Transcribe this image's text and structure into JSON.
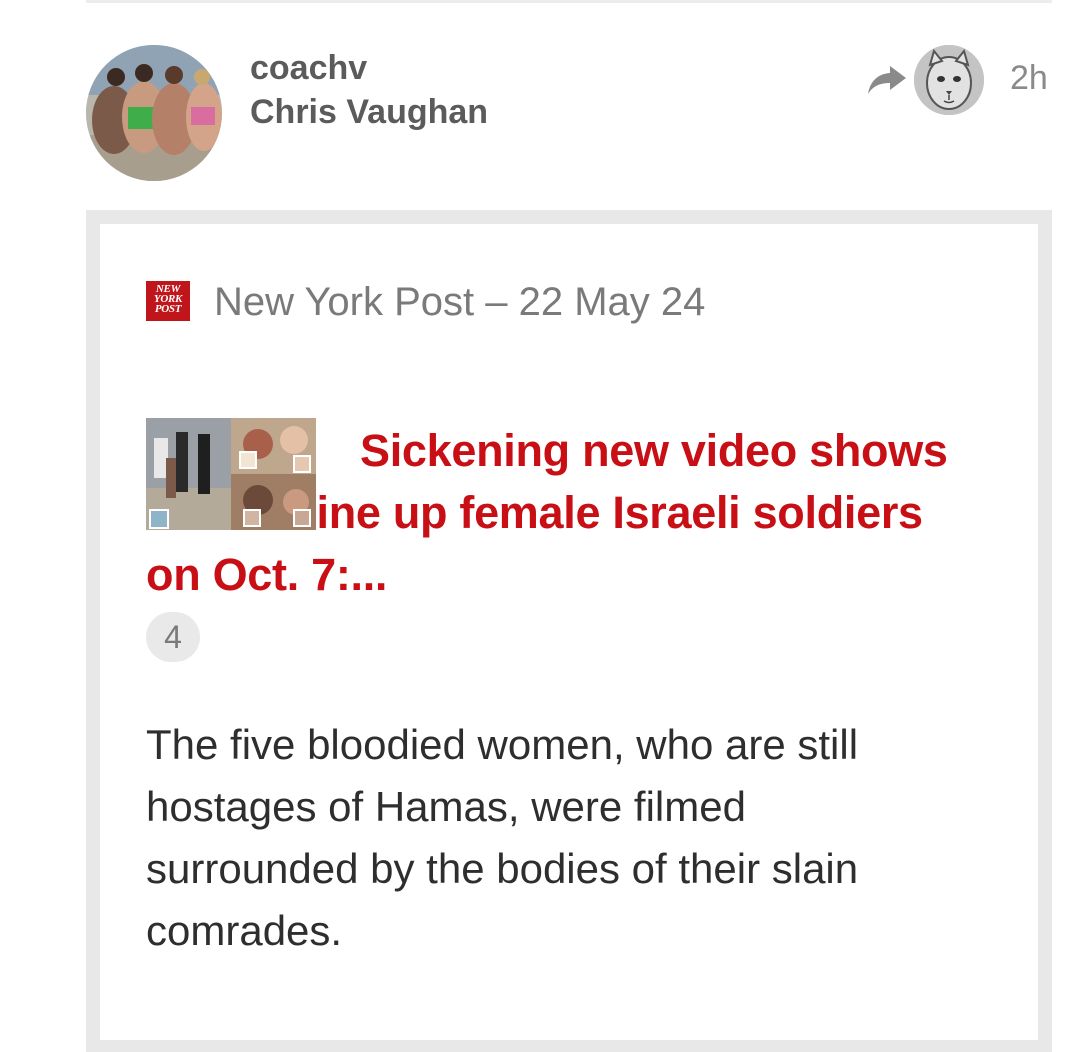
{
  "post": {
    "username": "coachv",
    "display_name": "Chris Vaughan",
    "time_ago": "2h",
    "avatar_icon": "user-avatar-photo",
    "share_icon": "reshare-arrow-icon",
    "reposter_icon": "cat-drawing-avatar"
  },
  "card": {
    "source_logo_lines": [
      "NEW",
      "YORK",
      "POST"
    ],
    "source_line": "New York Post – 22 May 24",
    "headline": "Sickening new video shows Hamas line up female Israeli soldiers on Oct. 7:...",
    "comment_count": "4",
    "excerpt": "The five bloodied women, who are still hostages of Hamas, were filmed surrounded by the bodies of their slain comrades."
  },
  "colors": {
    "headline": "#c80f15",
    "logo_bg": "#c0161b",
    "meta_text": "#7a7a7a",
    "card_border": "#e8e8e8"
  }
}
